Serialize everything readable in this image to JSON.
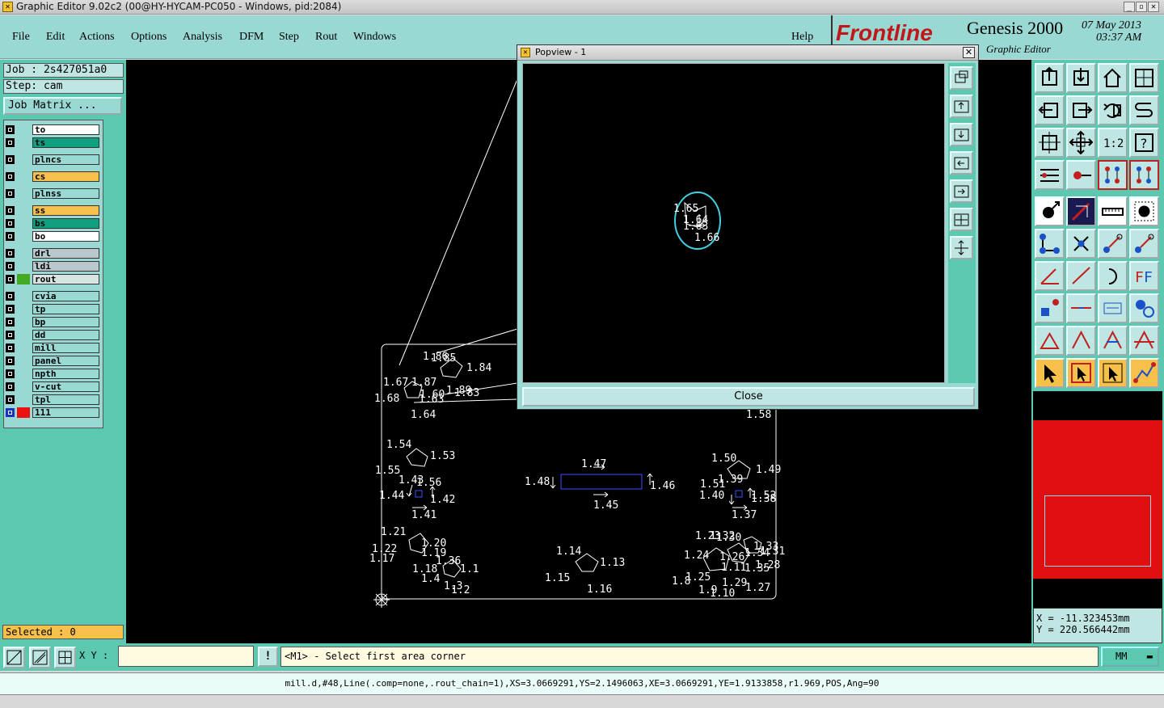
{
  "window": {
    "title": "Graphic Editor 9.02c2 (00@HY-HYCAM-PC050 - Windows, pid:2084)",
    "controls": [
      "_",
      "▫",
      "✕"
    ]
  },
  "menu": [
    "File",
    "Edit",
    "Actions",
    "Options",
    "Analysis",
    "DFM",
    "Step",
    "Rout",
    "Windows",
    "Help"
  ],
  "brand": {
    "logo": "Frontline",
    "product": "Genesis 2000",
    "subtitle": "Graphic Editor",
    "date": "07 May 2013",
    "time": "03:37 AM"
  },
  "job": {
    "job_label": "Job : 2s427051a0",
    "step_label": "Step: cam",
    "matrix_button": "Job Matrix ..."
  },
  "layers": [
    {
      "name": "to",
      "bg": "#ffffff"
    },
    {
      "name": "ts",
      "bg": "#0fa080"
    },
    {
      "name": "plncs",
      "bg": "#9ad8d4"
    },
    {
      "name": "cs",
      "bg": "#f6c04a"
    },
    {
      "name": "plnss",
      "bg": "#9ad8d4"
    },
    {
      "name": "ss",
      "bg": "#f6c04a"
    },
    {
      "name": "bs",
      "bg": "#0fa080"
    },
    {
      "name": "bo",
      "bg": "#ffffff"
    },
    {
      "name": "drl",
      "bg": "#b8c8cc"
    },
    {
      "name": "ldi",
      "bg": "#b8c8cc"
    },
    {
      "name": "rout",
      "bg": "#d8e4e4",
      "swatch": "#44aa22"
    },
    {
      "name": "cvia",
      "bg": "#9ad8d4"
    },
    {
      "name": "tp",
      "bg": "#9ad8d4"
    },
    {
      "name": "bp",
      "bg": "#9ad8d4"
    },
    {
      "name": "dd",
      "bg": "#9ad8d4"
    },
    {
      "name": "mill",
      "bg": "#9ad8d4"
    },
    {
      "name": "panel",
      "bg": "#9ad8d4"
    },
    {
      "name": "npth",
      "bg": "#9ad8d4"
    },
    {
      "name": "v-cut",
      "bg": "#9ad8d4"
    },
    {
      "name": "tpl",
      "bg": "#9ad8d4"
    },
    {
      "name": "111",
      "bg": "#9ad8d4",
      "swatch": "#ee1111"
    }
  ],
  "selected": "Selected : 0",
  "popview": {
    "title": "Popview - 1",
    "close_button": "Close",
    "labels": [
      "1.65",
      "1.64",
      "1.63",
      "1.66"
    ]
  },
  "canvas_labels": [
    "1.86",
    "1.85",
    "1.84",
    "1.67",
    "1.87",
    "1.60",
    "1.89",
    "1.83",
    "1.68",
    "1.63",
    "1.64",
    "1.54",
    "1.53",
    "1.55",
    "1.43",
    "1.56",
    "1.44",
    "1.42",
    "1.41",
    "1.47",
    "1.48",
    "1.46",
    "1.45",
    "1.50",
    "1.49",
    "1.51",
    "1.39",
    "1.40",
    "1.52",
    "1.38",
    "1.37",
    "1.58",
    "1.21",
    "1.20",
    "1.22",
    "1.19",
    "1.17",
    "1.36",
    "1.18",
    "1.1",
    "1.4",
    "1.3",
    "1.2",
    "1.14",
    "1.13",
    "1.15",
    "1.16",
    "1.23",
    "1.32",
    "1.30",
    "1.33",
    "1.34",
    "1.24",
    "1.26",
    "1.28",
    "1.11",
    "1.35",
    "1.8",
    "1.25",
    "1.9",
    "1.10",
    "1.27",
    "1.29",
    "1.31"
  ],
  "coords": {
    "x": "X = -11.323453mm",
    "y": "Y = 220.566442mm"
  },
  "bottom": {
    "xy_label": "X Y :",
    "warn": "!",
    "prompt": "<M1> - Select first area corner",
    "units": "MM",
    "status": "mill.d,#48,Line(.comp=none,.rout_chain=1),XS=3.0669291,YS=2.1496063,XE=3.0669291,YE=1.9133858,r1.969,POS,Ang=90"
  },
  "colors": {
    "panel": "#5cc8b0",
    "menu": "#9ad8d4",
    "canvas": "#000000",
    "overview": "#e01010",
    "accent_yellow": "#f6c04a"
  }
}
